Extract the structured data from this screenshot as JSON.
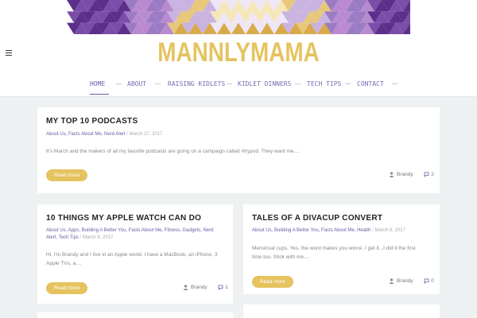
{
  "site": {
    "logo": "MANNLYMAMA",
    "colors": {
      "accent": "#e5c35f",
      "nav": "#6a5ba8",
      "background": "#eef1f2"
    }
  },
  "nav": {
    "items": [
      "HOME",
      "ABOUT",
      "RAISING KIDLETS",
      "KIDLET DINNERS",
      "TECH TIPS",
      "CONTACT"
    ],
    "active": "HOME"
  },
  "posts": [
    {
      "title": "MY TOP 10 PODCASTS",
      "categories": "About Us, Facts About Me, Nerd Alert",
      "date": "March 27, 2017",
      "excerpt": "It's March and the makers of all my favorite podcasts are going on a campaign called #trypod. They want me....",
      "read_more": "Read more",
      "author": "Brandy",
      "comments": "2"
    },
    {
      "title": "10 THINGS MY APPLE WATCH CAN DO",
      "categories_line1": "About Us, Apps, Building A Better You, Facts About Me, Fitness, Gadgets, Nerd",
      "categories_line2": "Alert, Tech Tips",
      "date": "March 9, 2017",
      "excerpt_line1": "Hi. I'm Brandy and I live in an Apple world. I have a MacBook, an iPhone, 3",
      "excerpt_line2": "Apple TVs, a....",
      "read_more": "Read more",
      "author": "Brandy",
      "comments": "1"
    },
    {
      "title": "TALES OF A DIVACUP CONVERT",
      "categories": "About Us, Building A Better You, Facts About Me, Health",
      "date": "March 8, 2017",
      "excerpt_line1": "Menstrual cups. Yes, the word makes you wince. I get it...I did it the first",
      "excerpt_line2": "time too. Stick with me....",
      "read_more": "Read more",
      "author": "Brandy",
      "comments": "0"
    }
  ],
  "icons": {
    "menu": "hamburger-icon",
    "author": "user-icon",
    "comments": "comment-bubble-icon"
  }
}
